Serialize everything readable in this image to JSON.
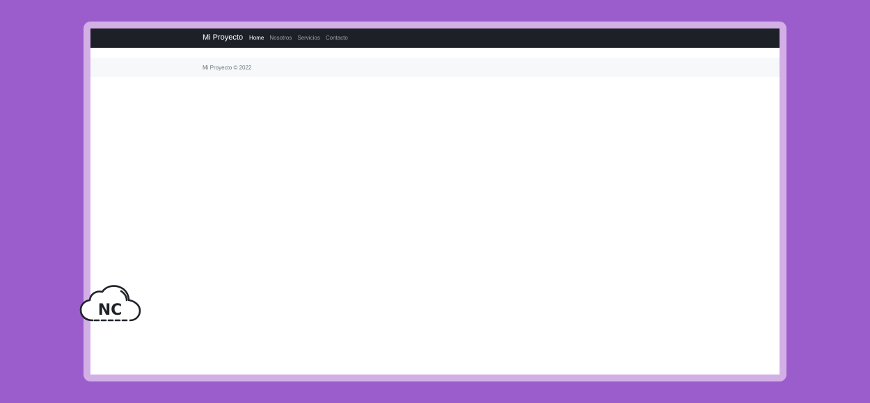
{
  "navbar": {
    "brand": "Mi Proyecto",
    "links": [
      {
        "label": "Home",
        "active": true
      },
      {
        "label": "Nosotros",
        "active": false
      },
      {
        "label": "Servicios",
        "active": false
      },
      {
        "label": "Contacto",
        "active": false
      }
    ]
  },
  "footer": {
    "text": "Mi Proyecto © 2022"
  },
  "logo": {
    "text": "NC",
    "icon": "cloud-icon"
  },
  "colors": {
    "background": "#9b5dcb",
    "frame": "#d2b0e6",
    "navbar": "#1d2127",
    "footer": "#f7f8f9"
  }
}
